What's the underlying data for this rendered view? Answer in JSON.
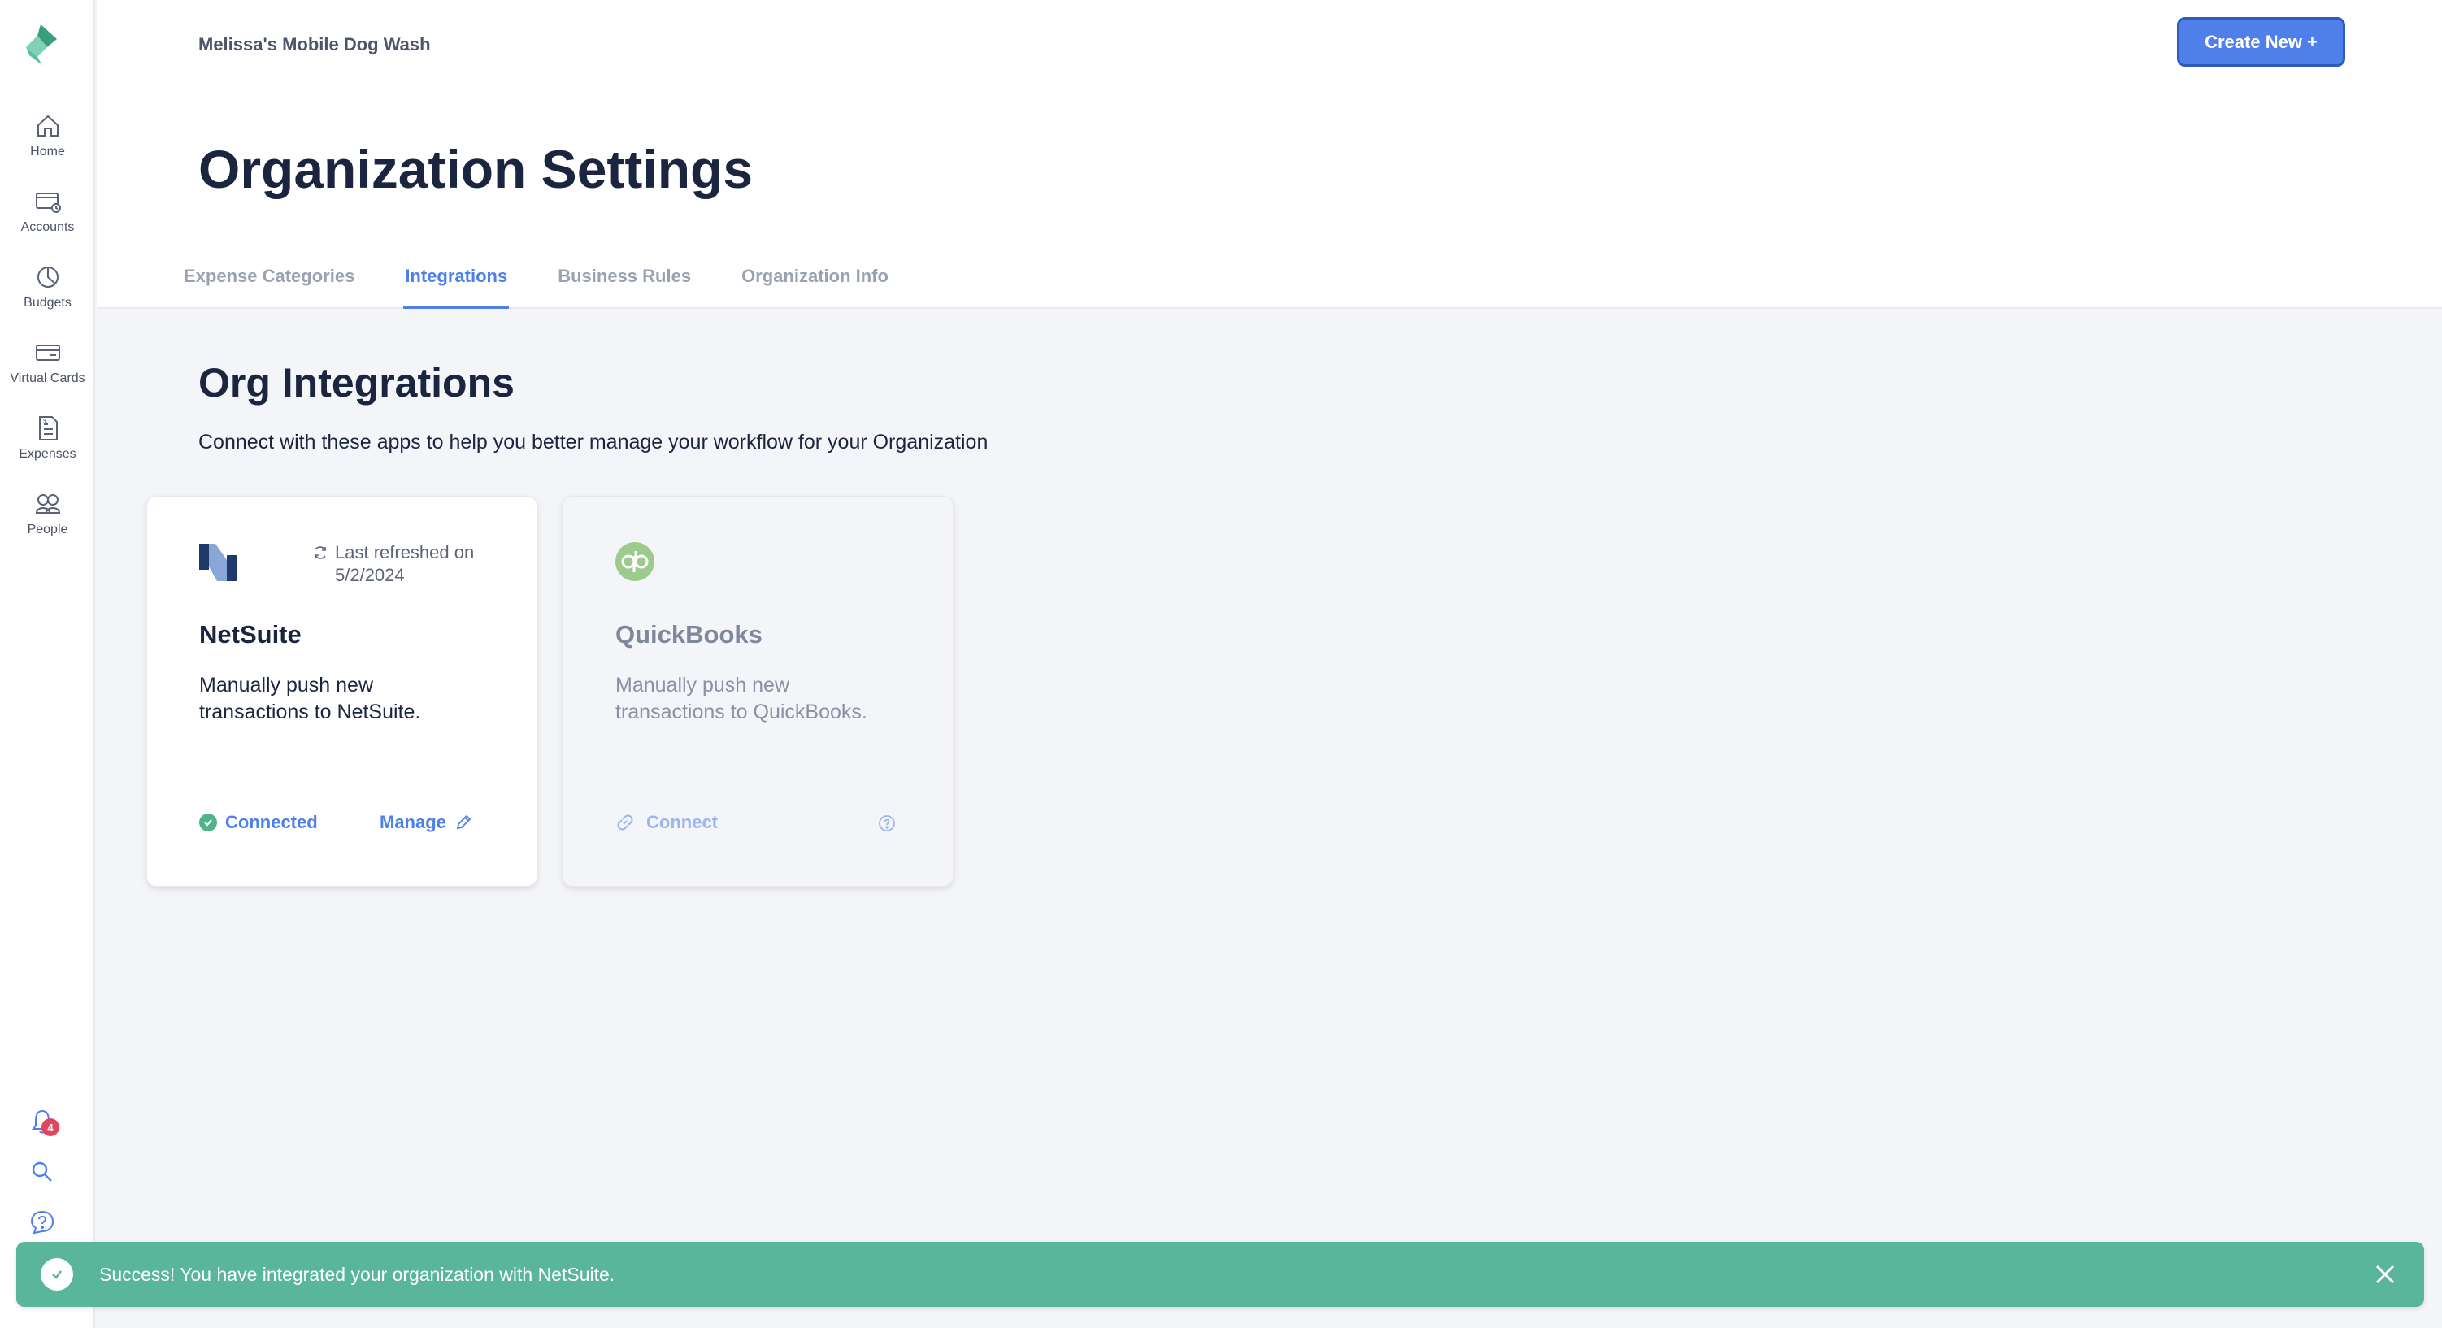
{
  "sidebar": {
    "items": [
      {
        "label": "Home",
        "icon": "home-icon"
      },
      {
        "label": "Accounts",
        "icon": "accounts-icon"
      },
      {
        "label": "Budgets",
        "icon": "budgets-icon"
      },
      {
        "label": "Virtual Cards",
        "icon": "card-icon"
      },
      {
        "label": "Expenses",
        "icon": "expenses-icon"
      },
      {
        "label": "People",
        "icon": "people-icon"
      }
    ],
    "notification_count": "4",
    "bottom_icons": [
      "bell-icon",
      "search-icon",
      "help-icon"
    ]
  },
  "header": {
    "org_name": "Melissa's Mobile Dog Wash",
    "create_button": "Create New +",
    "page_title": "Organization Settings",
    "tabs": [
      {
        "label": "Expense Categories",
        "active": false
      },
      {
        "label": "Integrations",
        "active": true
      },
      {
        "label": "Business Rules",
        "active": false
      },
      {
        "label": "Organization Info",
        "active": false
      }
    ]
  },
  "main": {
    "section_title": "Org Integrations",
    "section_description": "Connect with these apps to help you better manage your workflow for your Organization",
    "integrations": [
      {
        "name": "NetSuite",
        "description": "Manually push new transactions to NetSuite.",
        "refresh_text": "Last refreshed on 5/2/2024",
        "status": "Connected",
        "action": "Manage",
        "logo": "netsuite-logo"
      },
      {
        "name": "QuickBooks",
        "description": "Manually push new transactions to QuickBooks.",
        "action": "Connect",
        "logo": "quickbooks-logo"
      }
    ]
  },
  "toast": {
    "message": "Success! You have integrated your organization with NetSuite."
  },
  "colors": {
    "accent": "#4f7fe8",
    "success": "#5ab69a",
    "heading": "#1c2540",
    "badge": "#e0475a"
  }
}
